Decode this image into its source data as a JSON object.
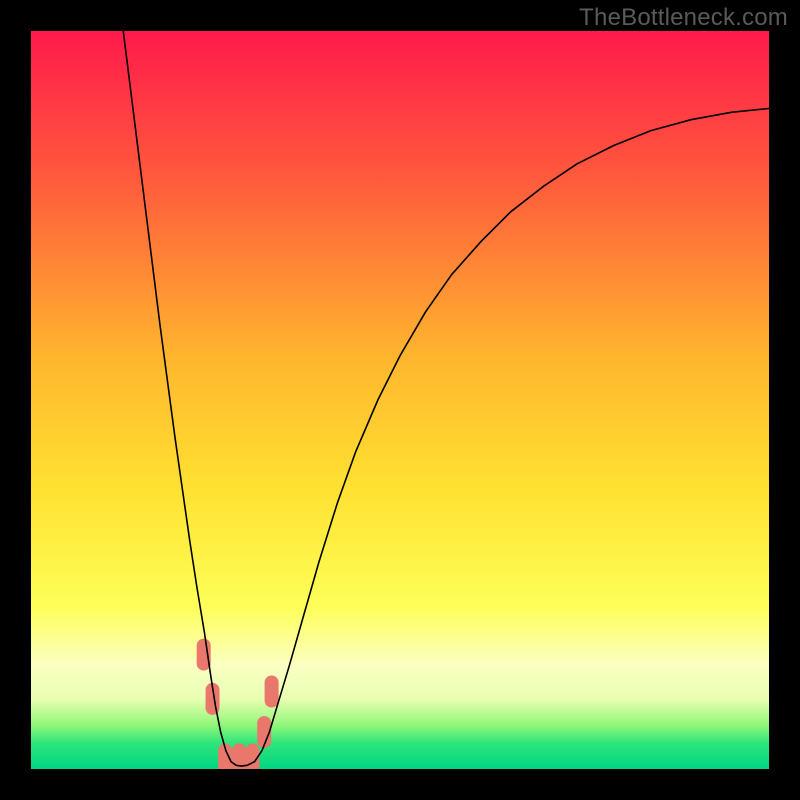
{
  "watermark": "TheBottleneck.com",
  "chart_data": {
    "type": "line",
    "title": "",
    "xlabel": "",
    "ylabel": "",
    "xlim": [
      0,
      100
    ],
    "ylim": [
      0,
      100
    ],
    "grid": false,
    "legend": false,
    "background_gradient": {
      "stops": [
        {
          "offset": 0.0,
          "color": "#ff1a4b"
        },
        {
          "offset": 0.2,
          "color": "#ff5a3c"
        },
        {
          "offset": 0.45,
          "color": "#ffb82e"
        },
        {
          "offset": 0.62,
          "color": "#ffe131"
        },
        {
          "offset": 0.78,
          "color": "#fdff58"
        },
        {
          "offset": 0.86,
          "color": "#fbffc2"
        },
        {
          "offset": 0.905,
          "color": "#e8ffb1"
        },
        {
          "offset": 0.94,
          "color": "#93f77a"
        },
        {
          "offset": 0.965,
          "color": "#2fe57a"
        },
        {
          "offset": 1.0,
          "color": "#00d683"
        }
      ]
    },
    "series": [
      {
        "name": "bottleneck-curve",
        "color": "#000000",
        "stroke_width": 1.6,
        "x": [
          12.5,
          13.5,
          14.5,
          15.5,
          16.5,
          17.5,
          18.5,
          19.5,
          20.5,
          21.5,
          22.5,
          23.5,
          24.3,
          25.0,
          25.7,
          26.4,
          27.1,
          27.8,
          28.5,
          29.3,
          30.3,
          31.3,
          32.3,
          33.5,
          35.0,
          37.0,
          39.0,
          41.5,
          44.0,
          47.0,
          50.0,
          53.5,
          57.0,
          61.0,
          65.0,
          69.5,
          74.0,
          79.0,
          84.0,
          89.5,
          95.0,
          100.0
        ],
        "y": [
          100.0,
          92.0,
          84.0,
          76.0,
          68.0,
          60.0,
          52.5,
          45.0,
          38.0,
          31.0,
          24.5,
          18.5,
          13.0,
          8.5,
          5.0,
          2.5,
          1.0,
          0.5,
          0.4,
          0.5,
          1.0,
          2.5,
          5.0,
          9.0,
          14.0,
          21.0,
          28.0,
          36.0,
          43.0,
          50.0,
          56.0,
          62.0,
          67.0,
          71.5,
          75.5,
          79.0,
          82.0,
          84.5,
          86.5,
          88.0,
          89.0,
          89.5
        ]
      }
    ],
    "markers": {
      "name": "highlight-range",
      "color": "#e9776c",
      "shape": "rounded-rect",
      "points": [
        {
          "x": 23.4,
          "y": 15.5
        },
        {
          "x": 24.6,
          "y": 9.5
        },
        {
          "x": 26.3,
          "y": 1.3
        },
        {
          "x": 28.2,
          "y": 1.3
        },
        {
          "x": 30.0,
          "y": 1.3
        },
        {
          "x": 31.6,
          "y": 5.0
        },
        {
          "x": 32.6,
          "y": 10.5
        }
      ]
    }
  }
}
